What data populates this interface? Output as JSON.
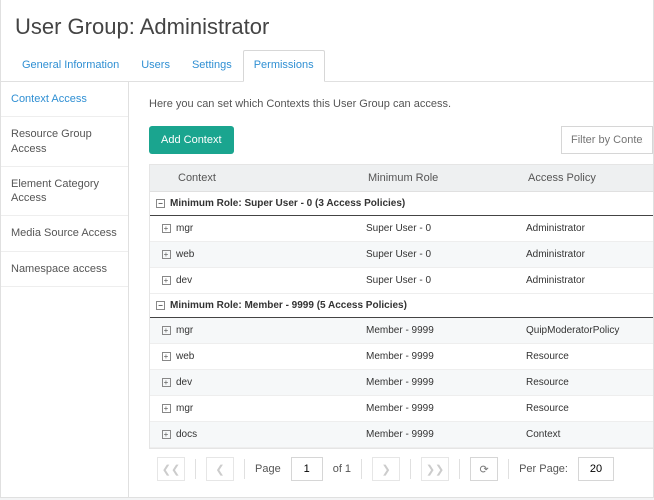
{
  "page_title": "User Group: Administrator",
  "tabs": [
    {
      "label": "General Information"
    },
    {
      "label": "Users"
    },
    {
      "label": "Settings"
    },
    {
      "label": "Permissions"
    }
  ],
  "active_tab": 3,
  "sidebar": {
    "items": [
      {
        "label": "Context Access"
      },
      {
        "label": "Resource Group Access"
      },
      {
        "label": "Element Category Access"
      },
      {
        "label": "Media Source Access"
      },
      {
        "label": "Namespace access"
      }
    ],
    "active": 0
  },
  "help_text": "Here you can set which Contexts this User Group can access.",
  "toolbar": {
    "add_button": "Add Context",
    "filter_placeholder": "Filter by Context"
  },
  "grid": {
    "columns": {
      "context": "Context",
      "min_role": "Minimum Role",
      "policy": "Access Policy"
    },
    "groups": [
      {
        "title": "Minimum Role: Super User - 0 (3 Access Policies)",
        "rows": [
          {
            "context": "mgr",
            "role": "Super User - 0",
            "policy": "Administrator"
          },
          {
            "context": "web",
            "role": "Super User - 0",
            "policy": "Administrator"
          },
          {
            "context": "dev",
            "role": "Super User - 0",
            "policy": "Administrator"
          }
        ]
      },
      {
        "title": "Minimum Role: Member - 9999 (5 Access Policies)",
        "rows": [
          {
            "context": "mgr",
            "role": "Member - 9999",
            "policy": "QuipModeratorPolicy"
          },
          {
            "context": "web",
            "role": "Member - 9999",
            "policy": "Resource"
          },
          {
            "context": "dev",
            "role": "Member - 9999",
            "policy": "Resource"
          },
          {
            "context": "mgr",
            "role": "Member - 9999",
            "policy": "Resource"
          },
          {
            "context": "docs",
            "role": "Member - 9999",
            "policy": "Context"
          }
        ]
      }
    ]
  },
  "pager": {
    "page_label": "Page",
    "current": "1",
    "of_label": "of 1",
    "per_page_label": "Per Page:",
    "per_page_value": "20"
  },
  "glyphs": {
    "minus": "−",
    "plus": "+",
    "first": "❮❮",
    "prev": "❮",
    "next": "❯",
    "last": "❯❯",
    "refresh": "⟳"
  }
}
